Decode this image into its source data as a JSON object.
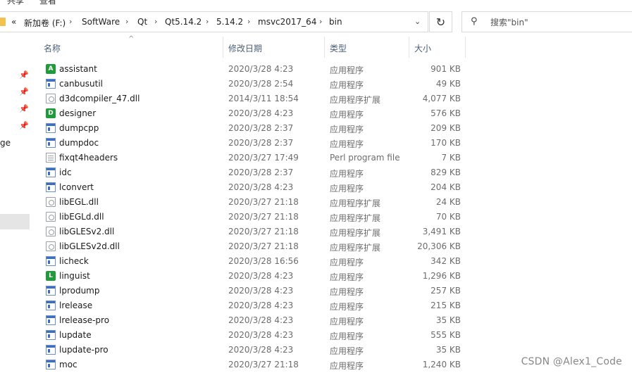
{
  "ribbon": {
    "tab1": "共享",
    "tab2": "查看"
  },
  "address": {
    "overflow": "«",
    "crumbs": [
      "新加卷 (F:)",
      "SoftWare",
      "Qt",
      "Qt5.14.2",
      "5.14.2",
      "msvc2017_64",
      "bin"
    ]
  },
  "search": {
    "placeholder": "搜索\"bin\""
  },
  "nav": {
    "partial_text": "ge"
  },
  "columns": {
    "name": "名称",
    "date": "修改日期",
    "type": "类型",
    "size": "大小"
  },
  "files": [
    {
      "name": "assistant",
      "date": "2020/3/28 4:23",
      "type": "应用程序",
      "size": "901 KB",
      "icon": "app",
      "letter": "A"
    },
    {
      "name": "canbusutil",
      "date": "2020/3/28 2:54",
      "type": "应用程序",
      "size": "49 KB",
      "icon": "exe"
    },
    {
      "name": "d3dcompiler_47.dll",
      "date": "2014/3/11 18:54",
      "type": "应用程序扩展",
      "size": "4,077 KB",
      "icon": "dll"
    },
    {
      "name": "designer",
      "date": "2020/3/28 4:23",
      "type": "应用程序",
      "size": "576 KB",
      "icon": "app",
      "letter": "D"
    },
    {
      "name": "dumpcpp",
      "date": "2020/3/28 2:37",
      "type": "应用程序",
      "size": "209 KB",
      "icon": "exe"
    },
    {
      "name": "dumpdoc",
      "date": "2020/3/28 2:37",
      "type": "应用程序",
      "size": "170 KB",
      "icon": "exe"
    },
    {
      "name": "fixqt4headers",
      "date": "2020/3/27 17:49",
      "type": "Perl program file",
      "size": "7 KB",
      "icon": "file"
    },
    {
      "name": "idc",
      "date": "2020/3/28 2:37",
      "type": "应用程序",
      "size": "829 KB",
      "icon": "exe"
    },
    {
      "name": "lconvert",
      "date": "2020/3/28 4:23",
      "type": "应用程序",
      "size": "204 KB",
      "icon": "exe"
    },
    {
      "name": "libEGL.dll",
      "date": "2020/3/27 21:18",
      "type": "应用程序扩展",
      "size": "24 KB",
      "icon": "dll"
    },
    {
      "name": "libEGLd.dll",
      "date": "2020/3/27 21:18",
      "type": "应用程序扩展",
      "size": "70 KB",
      "icon": "dll"
    },
    {
      "name": "libGLESv2.dll",
      "date": "2020/3/27 21:18",
      "type": "应用程序扩展",
      "size": "3,491 KB",
      "icon": "dll"
    },
    {
      "name": "libGLESv2d.dll",
      "date": "2020/3/27 21:18",
      "type": "应用程序扩展",
      "size": "20,306 KB",
      "icon": "dll"
    },
    {
      "name": "licheck",
      "date": "2020/3/28 16:56",
      "type": "应用程序",
      "size": "342 KB",
      "icon": "exe"
    },
    {
      "name": "linguist",
      "date": "2020/3/28 4:23",
      "type": "应用程序",
      "size": "1,296 KB",
      "icon": "app",
      "letter": "L"
    },
    {
      "name": "lprodump",
      "date": "2020/3/28 4:23",
      "type": "应用程序",
      "size": "257 KB",
      "icon": "exe"
    },
    {
      "name": "lrelease",
      "date": "2020/3/28 4:23",
      "type": "应用程序",
      "size": "215 KB",
      "icon": "exe"
    },
    {
      "name": "lrelease-pro",
      "date": "2020/3/28 4:23",
      "type": "应用程序",
      "size": "35 KB",
      "icon": "exe"
    },
    {
      "name": "lupdate",
      "date": "2020/3/28 4:23",
      "type": "应用程序",
      "size": "555 KB",
      "icon": "exe"
    },
    {
      "name": "lupdate-pro",
      "date": "2020/3/28 4:23",
      "type": "应用程序",
      "size": "35 KB",
      "icon": "exe"
    },
    {
      "name": "moc",
      "date": "2020/3/27 21:18",
      "type": "应用程序",
      "size": "1,240 KB",
      "icon": "exe"
    }
  ],
  "watermark": "CSDN @Alex1_Code"
}
